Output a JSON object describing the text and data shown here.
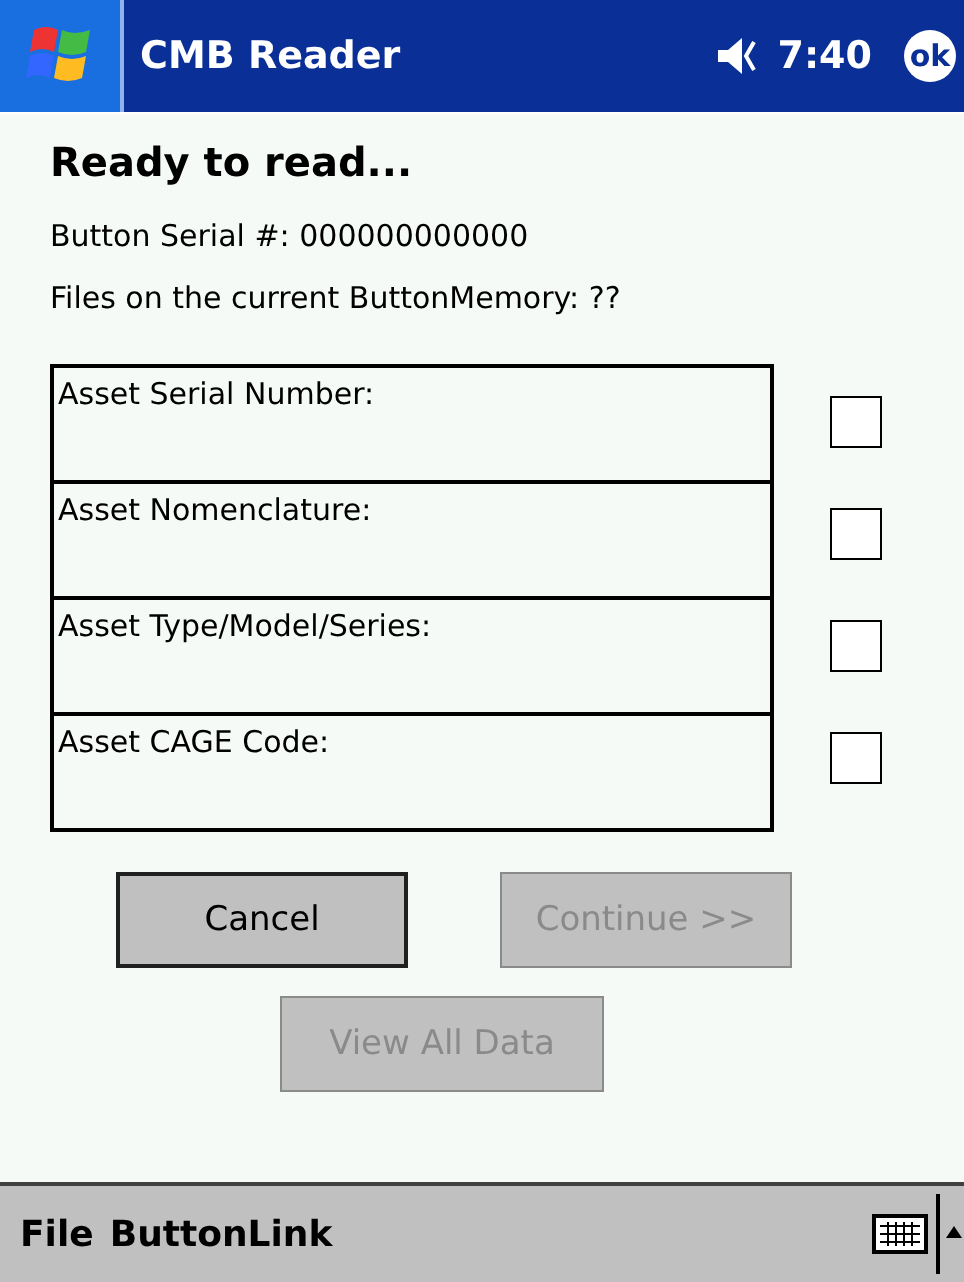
{
  "title_bar": {
    "title": "CMB Reader",
    "time": "7:40",
    "ok_label": "ok"
  },
  "heading": "Ready to read...",
  "info_lines": [
    "Button Serial #: 000000000000",
    "Files on the current ButtonMemory: ??"
  ],
  "fields": [
    {
      "label": "Asset Serial Number:",
      "checked": false
    },
    {
      "label": "Asset Nomenclature:",
      "checked": false
    },
    {
      "label": "Asset Type/Model/Series:",
      "checked": false
    },
    {
      "label": "Asset CAGE Code:",
      "checked": false
    }
  ],
  "buttons": [
    {
      "label": "Cancel",
      "disabled": false
    },
    {
      "label": "Continue >>",
      "disabled": true
    },
    {
      "label": "View All Data",
      "disabled": true
    }
  ],
  "menu_bar": {
    "items": [
      "File",
      "ButtonLink"
    ]
  }
}
